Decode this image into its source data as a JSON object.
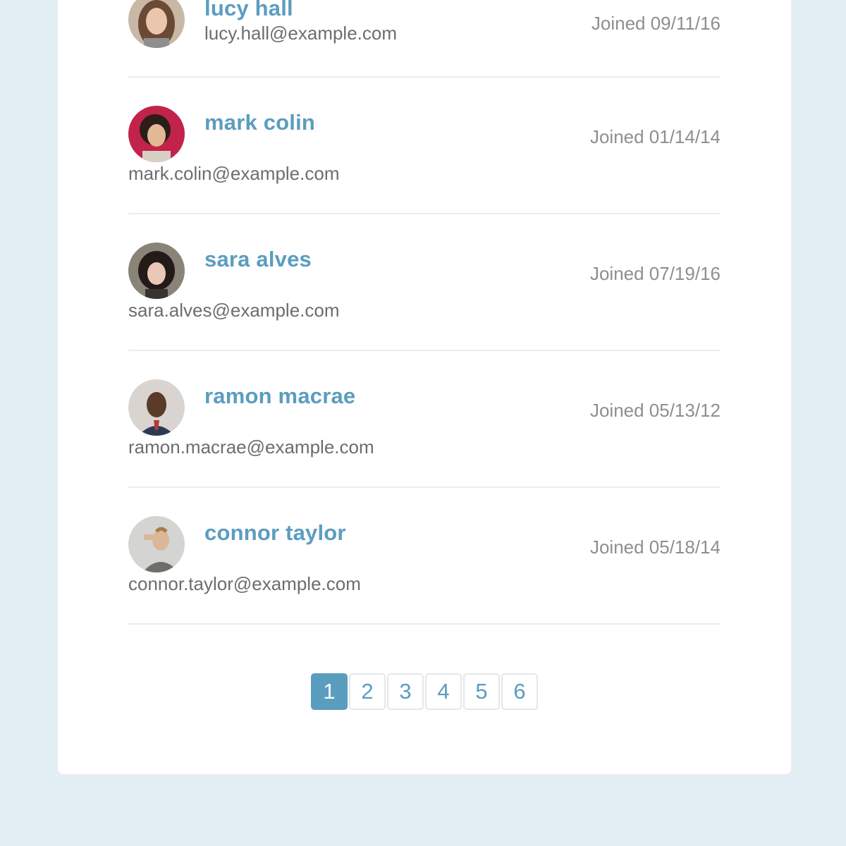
{
  "users": [
    {
      "name": "lucy hall",
      "email": "lucy.hall@example.com",
      "joined": "Joined 09/11/16"
    },
    {
      "name": "mark colin",
      "email": "mark.colin@example.com",
      "joined": "Joined 01/14/14"
    },
    {
      "name": "sara alves",
      "email": "sara.alves@example.com",
      "joined": "Joined 07/19/16"
    },
    {
      "name": "ramon macrae",
      "email": "ramon.macrae@example.com",
      "joined": "Joined 05/13/12"
    },
    {
      "name": "connor taylor",
      "email": "connor.taylor@example.com",
      "joined": "Joined 05/18/14"
    }
  ],
  "pagination": {
    "pages": [
      "1",
      "2",
      "3",
      "4",
      "5",
      "6"
    ],
    "current": "1"
  },
  "colors": {
    "accent": "#5b9dbf",
    "background": "#e4eff5",
    "card": "#ffffff"
  }
}
